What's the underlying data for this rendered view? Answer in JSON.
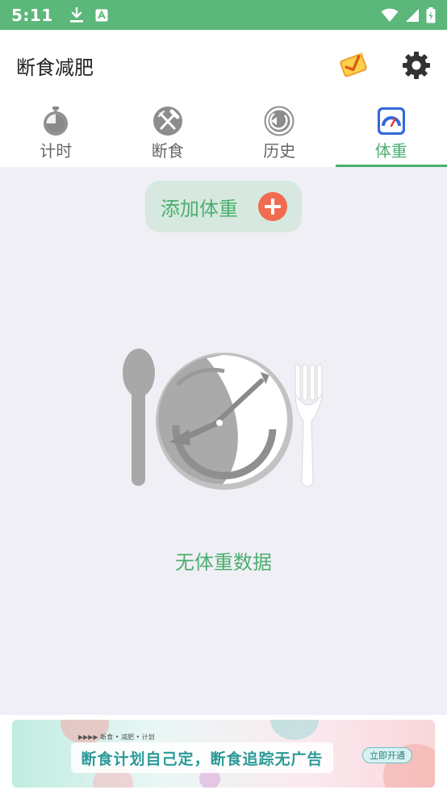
{
  "status_bar": {
    "time": "5:11",
    "icons": [
      "download-icon",
      "text-a-icon",
      "wifi-icon",
      "signal-icon",
      "battery-charging-icon"
    ]
  },
  "app_bar": {
    "title": "断食减肥",
    "actions": [
      "vip-badge-icon",
      "settings-gear-icon"
    ]
  },
  "tabs": [
    {
      "label": "计时",
      "icon": "stopwatch-icon",
      "active": false
    },
    {
      "label": "断食",
      "icon": "fork-knife-icon",
      "active": false
    },
    {
      "label": "历史",
      "icon": "history-icon",
      "active": false
    },
    {
      "label": "体重",
      "icon": "scale-gauge-icon",
      "active": true
    }
  ],
  "main": {
    "add_weight_label": "添加体重",
    "empty_text": "无体重数据"
  },
  "banner": {
    "top_text": "▶▶▶▶   断食 • 减肥 • 计划",
    "main_text": "断食计划自己定，断食追踪无广告",
    "cta_label": "立即开通"
  },
  "colors": {
    "status_bar": "#5bb77a",
    "accent": "#4caf6e",
    "background": "#f1eff6",
    "add_button_bg": "#d6e8e0",
    "plus": "#f06b4f"
  }
}
